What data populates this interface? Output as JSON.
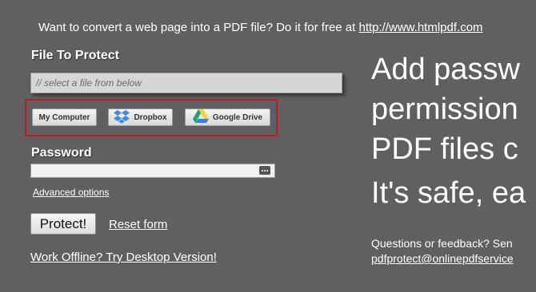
{
  "promo": {
    "text": "Want to convert a web page into a PDF file? Do it for free at",
    "link": "http://www.htmlpdf.com"
  },
  "file": {
    "label": "File To Protect",
    "placeholder": "// select a file from below",
    "sources": [
      {
        "label": "My Computer",
        "icon": "none"
      },
      {
        "label": "Dropbox",
        "icon": "dropbox-icon"
      },
      {
        "label": "Google Drive",
        "icon": "google-drive-icon"
      }
    ],
    "highlight_color": "#c41a24"
  },
  "password": {
    "label": "Password",
    "value": "",
    "advanced_link": "Advanced options"
  },
  "actions": {
    "protect_label": "Protect!",
    "reset_label": "Reset form",
    "offline_label": "Work Offline? Try Desktop Version!"
  },
  "hero": {
    "line1": "Add passw",
    "line2": "permission",
    "line3": "PDF files c",
    "line4": "It's safe, ea"
  },
  "contact": {
    "questions": "Questions or feedback? Sen",
    "email": "pdfprotect@onlinepdfservice"
  },
  "colors": {
    "background": "#606062",
    "text": "#ffffff",
    "dropbox_blue": "#3d8ae0",
    "drive_green": "#1fa463",
    "drive_yellow": "#ffcf3a",
    "drive_blue": "#3a7ee8"
  }
}
